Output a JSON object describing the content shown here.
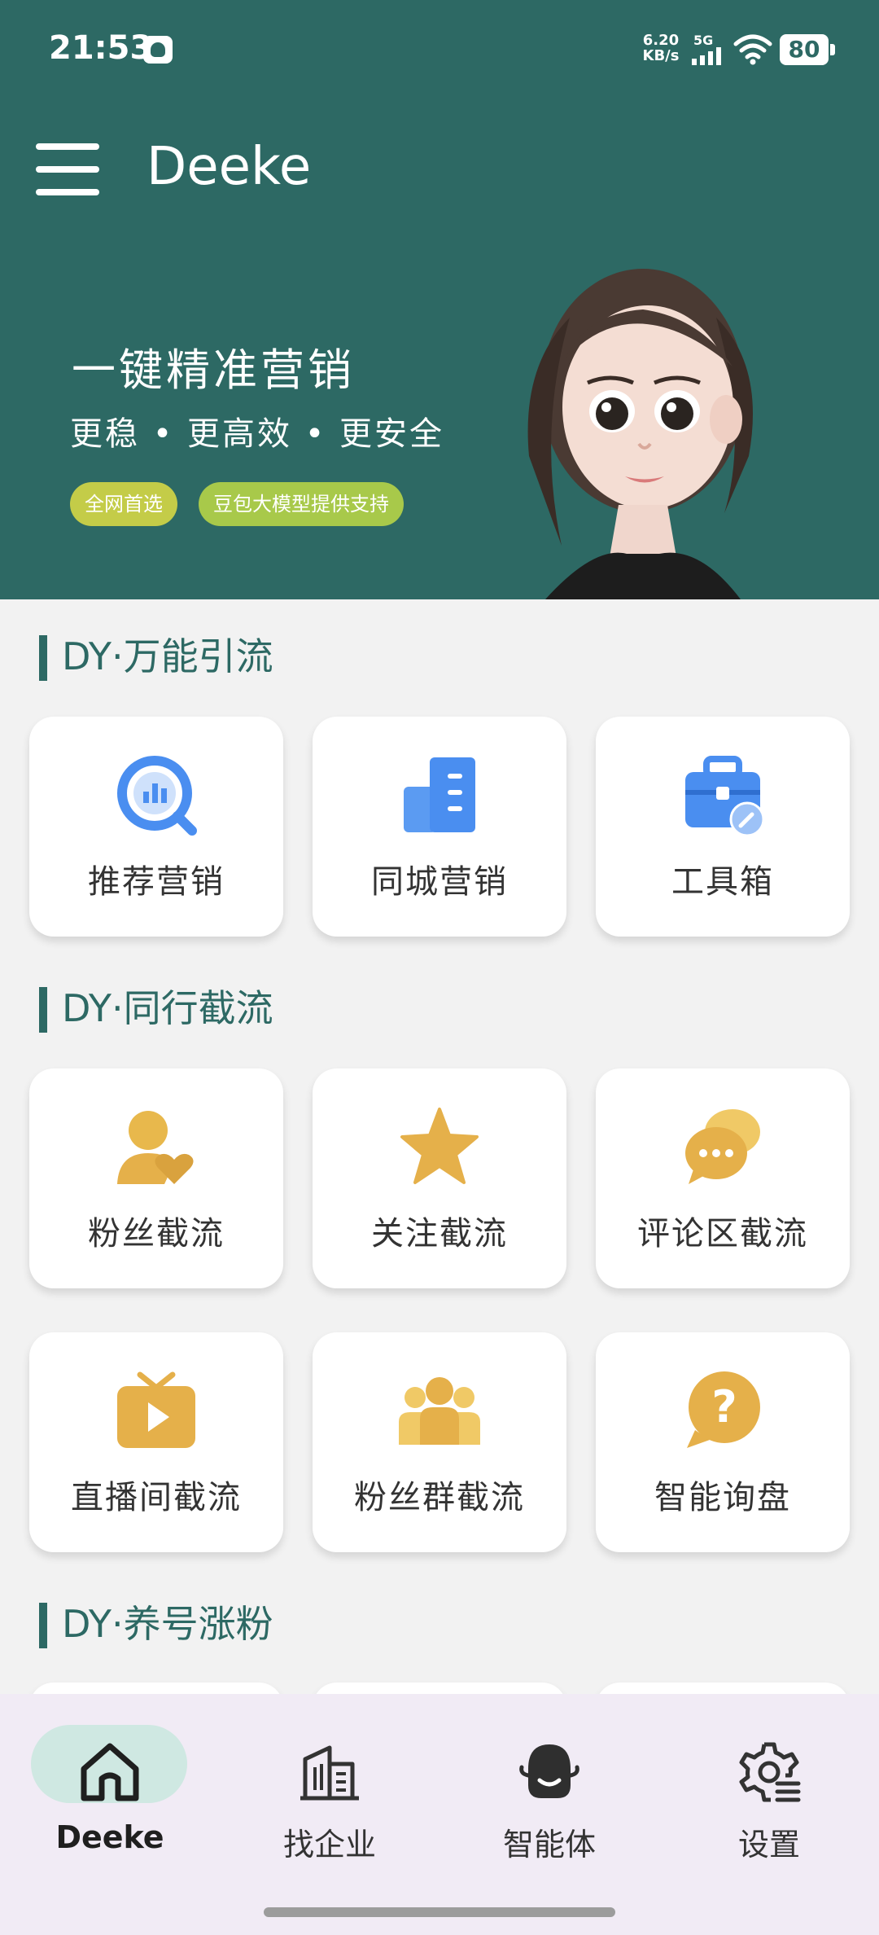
{
  "status_bar": {
    "time": "21:53",
    "speed_value": "6.20",
    "speed_unit": "KB/s",
    "network": "5G",
    "battery": "80"
  },
  "app": {
    "title": "Deeke"
  },
  "banner": {
    "title": "一键精准营销",
    "subtitle": "更稳 • 更高效 • 更安全",
    "tags": [
      "全网首选",
      "豆包大模型提供支持"
    ]
  },
  "sections": [
    {
      "title": "DY·万能引流",
      "items": [
        {
          "label": "推荐营销",
          "icon": "chart-target-icon"
        },
        {
          "label": "同城营销",
          "icon": "building-icon"
        },
        {
          "label": "工具箱",
          "icon": "toolbox-icon"
        }
      ]
    },
    {
      "title": "DY·同行截流",
      "items": [
        {
          "label": "粉丝截流",
          "icon": "user-heart-icon"
        },
        {
          "label": "关注截流",
          "icon": "star-icon"
        },
        {
          "label": "评论区截流",
          "icon": "chat-bubbles-icon"
        },
        {
          "label": "直播间截流",
          "icon": "tv-play-icon"
        },
        {
          "label": "粉丝群截流",
          "icon": "group-icon"
        },
        {
          "label": "智能询盘",
          "icon": "question-bubble-icon"
        }
      ]
    },
    {
      "title": "DY·养号涨粉",
      "items": []
    }
  ],
  "bottom_nav": [
    {
      "label": "Deeke",
      "icon": "home-icon",
      "active": true
    },
    {
      "label": "找企业",
      "icon": "office-building-icon",
      "active": false
    },
    {
      "label": "智能体",
      "icon": "agent-icon",
      "active": false
    },
    {
      "label": "设置",
      "icon": "settings-icon",
      "active": false
    }
  ],
  "colors": {
    "primary": "#2d6964",
    "blue_icon": "#4a8ef0",
    "gold_icon": "#e5b04a",
    "nav_bg": "#f1ebf5",
    "nav_active_pill": "#cfe8e2"
  }
}
